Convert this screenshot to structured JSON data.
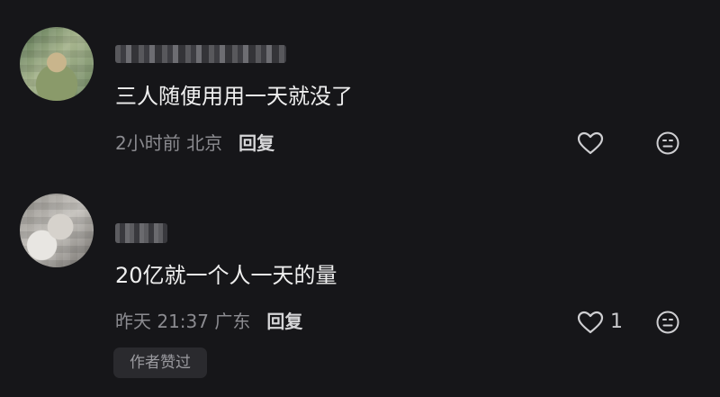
{
  "comments": [
    {
      "text": "三人随便用用一天就没了",
      "meta": "2小时前 北京",
      "reply_label": "回复",
      "like_count": "",
      "icons": {
        "like": "heart-icon",
        "react": "smiley-icon"
      }
    },
    {
      "username_fragment": "…",
      "text": "20亿就一个人一天的量",
      "meta": "昨天 21:37 广东",
      "reply_label": "回复",
      "like_count": "1",
      "author_badge": "作者赞过",
      "icons": {
        "like": "heart-icon",
        "react": "smiley-icon"
      }
    }
  ],
  "colors": {
    "background": "#161619",
    "text": "#efefef",
    "meta": "#8b8b90",
    "badge_bg": "#2a2a2e"
  }
}
